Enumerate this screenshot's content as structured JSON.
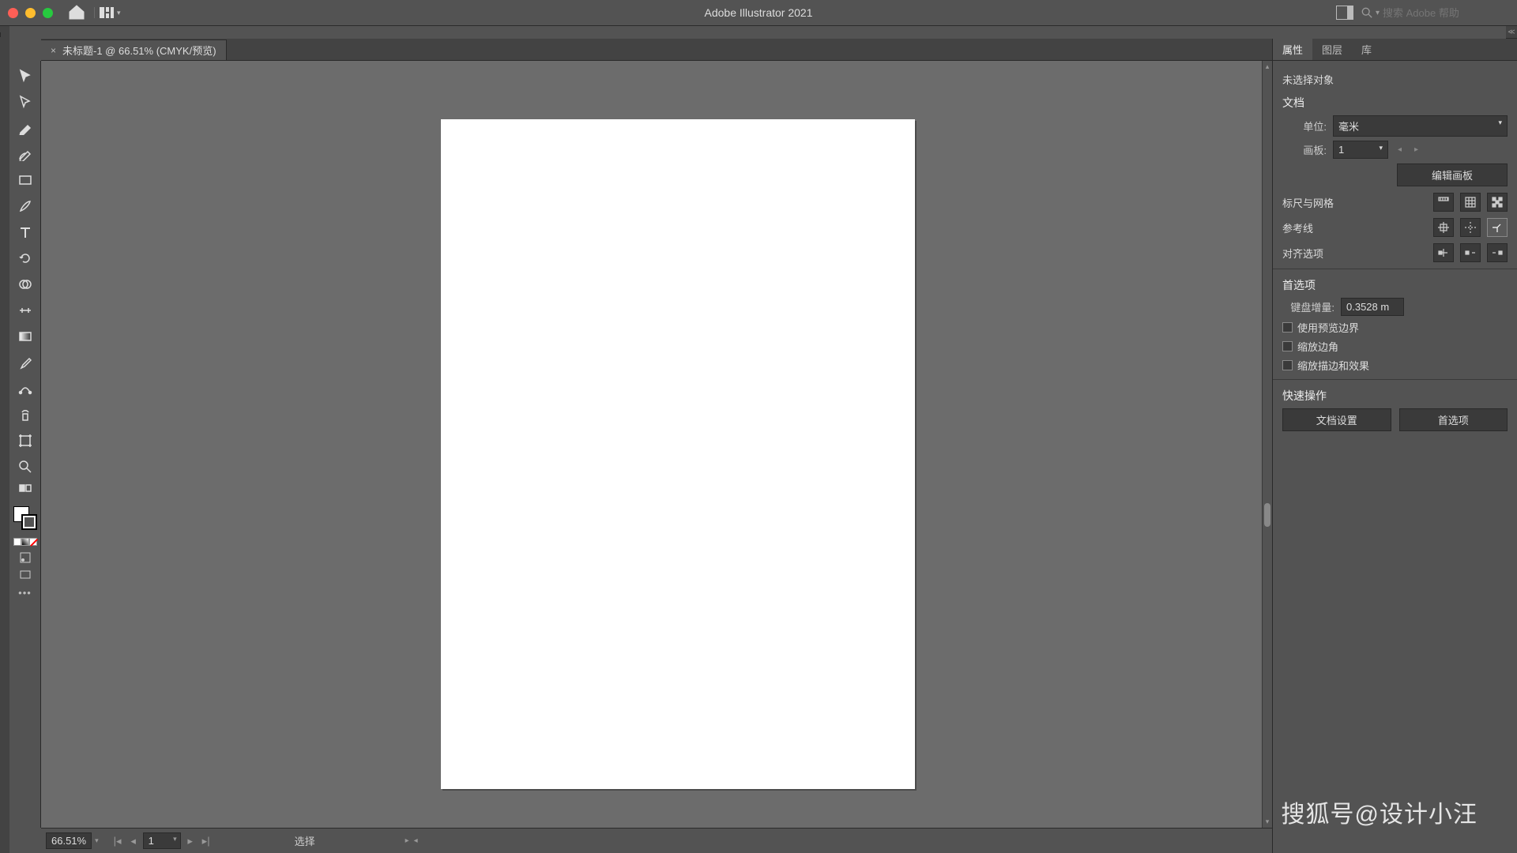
{
  "app_title": "Adobe Illustrator 2021",
  "search_placeholder": "搜索 Adobe 帮助",
  "document_tab": "未标题-1 @ 66.51% (CMYK/预览)",
  "status": {
    "zoom": "66.51%",
    "artboard_nav": "1",
    "mode": "选择"
  },
  "panel": {
    "tabs": [
      "属性",
      "图层",
      "库"
    ],
    "no_selection": "未选择对象",
    "section_document": "文档",
    "unit_label": "单位:",
    "unit_value": "毫米",
    "artboard_label": "画板:",
    "artboard_value": "1",
    "edit_artboard_btn": "编辑画板",
    "ruler_grid_label": "标尺与网格",
    "guides_label": "参考线",
    "align_label": "对齐选项",
    "section_prefs": "首选项",
    "key_inc_label": "键盘增量:",
    "key_inc_value": "0.3528 m",
    "chk_preview": "使用预览边界",
    "chk_scale_corners": "缩放边角",
    "chk_scale_strokes": "缩放描边和效果",
    "section_quick": "快速操作",
    "btn_doc_setup": "文档设置",
    "btn_prefs": "首选项"
  },
  "watermark": "搜狐号@设计小汪"
}
